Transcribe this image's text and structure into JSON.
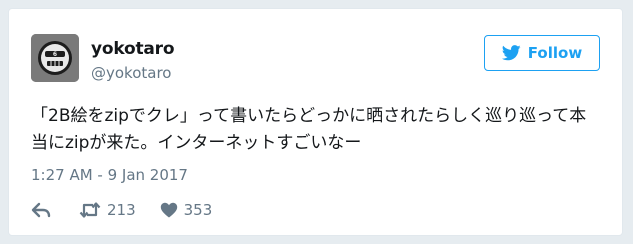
{
  "tweet": {
    "display_name": "yokotaro",
    "handle": "@yokotaro",
    "follow_label": "Follow",
    "text_line1": "「2B絵をzipでクレ」って書いたらどっかに晒されたらしく巡り巡って本",
    "text_line2": "当にzipが来た。インターネットすごいなー",
    "timestamp": "1:27 AM - 9 Jan 2017",
    "retweet_count": "213",
    "like_count": "353"
  },
  "icons": {
    "avatar": "robot-face-avatar",
    "follow": "twitter-bird-icon",
    "reply": "reply-icon",
    "retweet": "retweet-icon",
    "like": "heart-icon"
  },
  "colors": {
    "accent": "#1da1f2",
    "text": "#14171a",
    "muted": "#657786",
    "border": "#e1e8ed"
  }
}
